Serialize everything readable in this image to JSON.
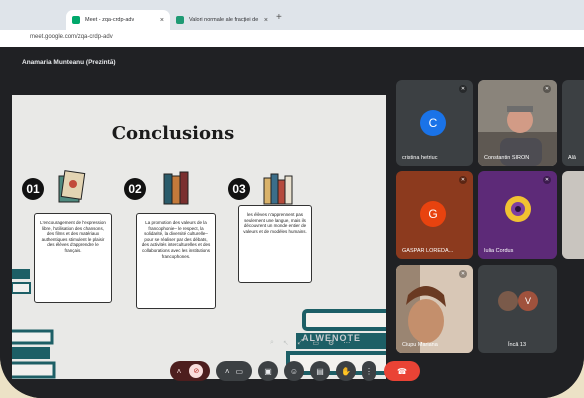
{
  "browser": {
    "tabs": [
      {
        "label": "Meet - zqa-crdp-adv",
        "active": true
      },
      {
        "label": "Valori normale ale fracției de v",
        "active": false
      }
    ],
    "url": "meet.google.com/zqa-crdp-adv"
  },
  "meeting": {
    "presenter_label": "Anamaria Munteanu (Prezintă)"
  },
  "slide": {
    "title": "Conclusions",
    "points": [
      {
        "number": "01",
        "text": "L'encouragement de l'expression libre, l'utilisation des chansons, des films et des matériaux authentiques stimulent le plaisir des élèves d'apprendre le français."
      },
      {
        "number": "02",
        "text": "La promotion des valeurs de la francophonie– le respect, la solidarité, la diversité culturelle– pour se réaliser par des débats, des activités interculturelles et des collaborations avec les institutions francophones."
      },
      {
        "number": "03",
        "text": "les élèves n'apprennent pas seulement une langue, mais ils découvrent un monde entier de valeurs et de modèles humains."
      }
    ],
    "watermark": "ALWENOTE"
  },
  "participants": [
    {
      "name": "cristina hetriuc",
      "initial": "C",
      "avatar_color": "#1a73e8",
      "tile_color": "#3c4043"
    },
    {
      "name": "Constantin SIRON",
      "initial": "",
      "avatar_color": "",
      "tile_color": "#6f6a64"
    },
    {
      "name": "Ală",
      "initial": "",
      "avatar_color": "",
      "tile_color": "#3c4043"
    },
    {
      "name": "GASPAR LOREDA...",
      "initial": "G",
      "avatar_color": "#e8430f",
      "tile_color": "#8c3a1e"
    },
    {
      "name": "Iulia Cordus",
      "initial": "",
      "avatar_color": "",
      "tile_color": "#5d2a78"
    },
    {
      "name": "Ciupu Mariana",
      "initial": "",
      "avatar_color": "",
      "tile_color": "#b7a08f"
    },
    {
      "name": "Încă 13",
      "initial": "V",
      "avatar_color": "#a0523d",
      "tile_color": "#3c4043"
    }
  ],
  "controls": {
    "end_call_color": "#ea4335",
    "mic_muted_color": "#f9dedc"
  },
  "icons": {
    "mic_off": "mic-off-icon",
    "camera": "camera-icon",
    "captions": "captions-icon",
    "emoji": "emoji-icon",
    "present": "present-icon",
    "hand": "raise-hand-icon",
    "more": "more-icon",
    "end_call": "end-call-icon"
  }
}
